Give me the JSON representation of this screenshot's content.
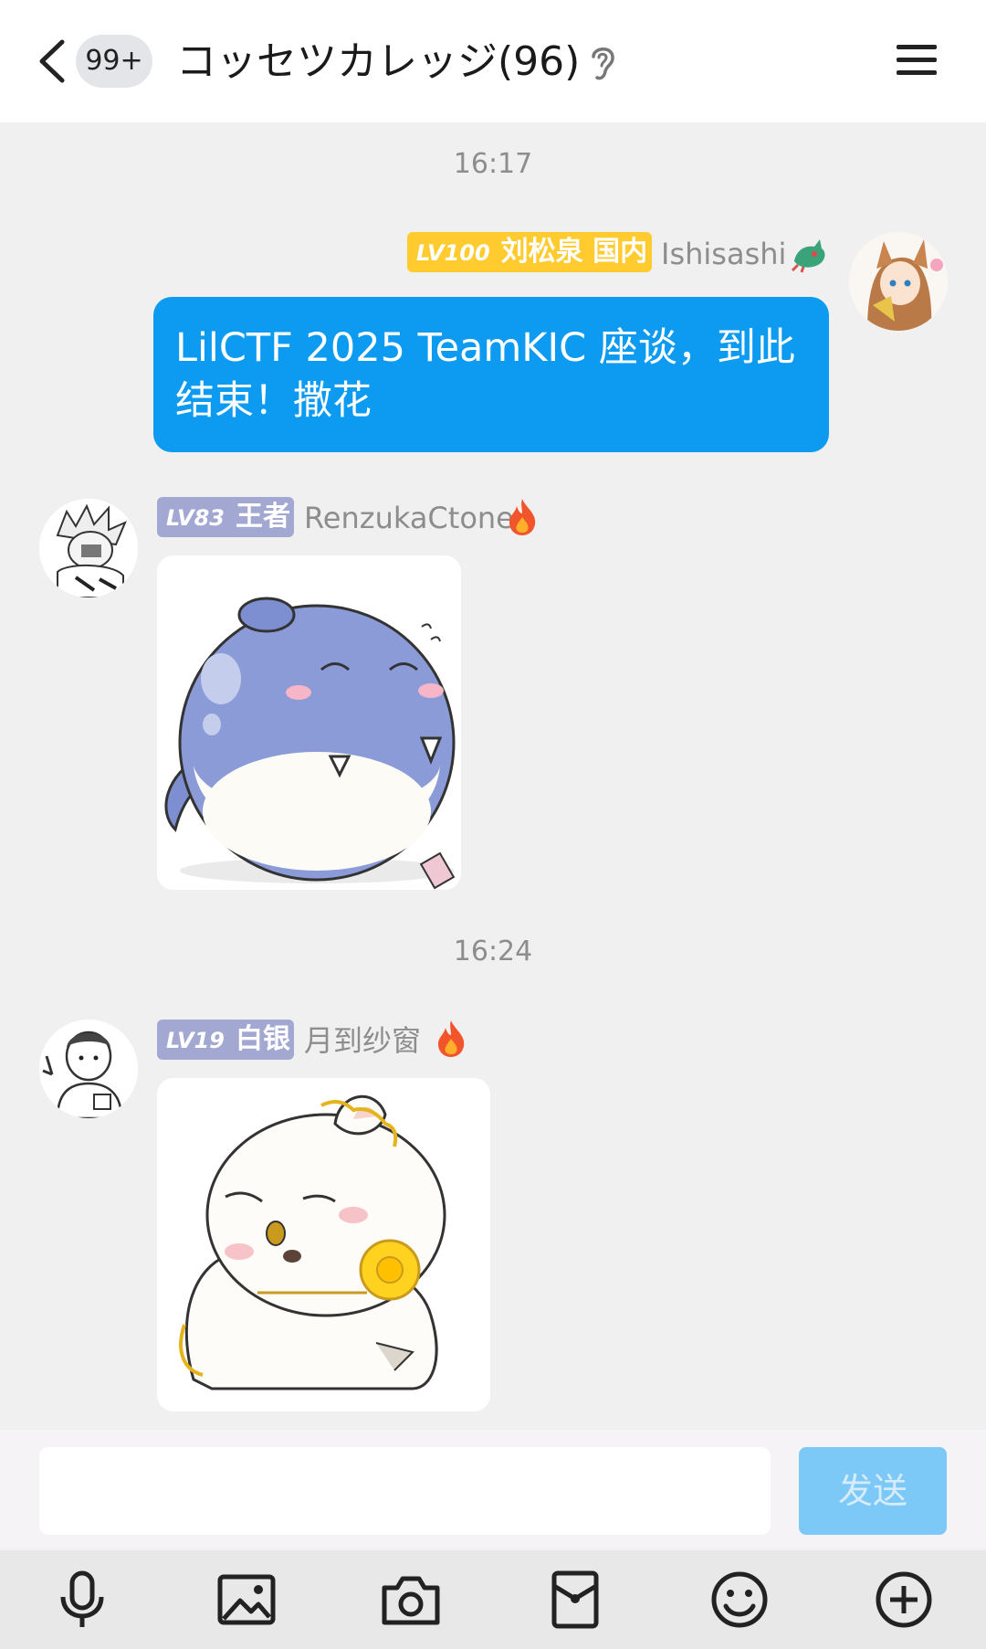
{
  "header": {
    "unread_badge": "99+",
    "title": "コッセツカレッジ(96)"
  },
  "messages": {
    "time1": "16:17",
    "time2": "16:24",
    "msg1": {
      "level": "LV100",
      "title_tag": "刘松泉 国内",
      "nickname": "Ishisashi",
      "text": "LilCTF 2025 TeamKIC 座谈，到此结束！撒花"
    },
    "msg2": {
      "level": "LV83",
      "title_tag": "王者",
      "nickname": "RenzukaCtone"
    },
    "msg3": {
      "level": "LV19",
      "title_tag": "白银",
      "nickname": "月到纱窗"
    }
  },
  "composer": {
    "input_value": "",
    "send_label": "发送"
  },
  "toolbar": [
    "mic-icon",
    "image-icon",
    "camera-icon",
    "red-packet-icon",
    "emoji-icon",
    "plus-icon"
  ],
  "colors": {
    "bubble": "#0d9bf2",
    "gold_tag": "#ffcb2f",
    "lavender_tag": "#a3a8d3",
    "send_disabled": "#7cc8f6"
  }
}
